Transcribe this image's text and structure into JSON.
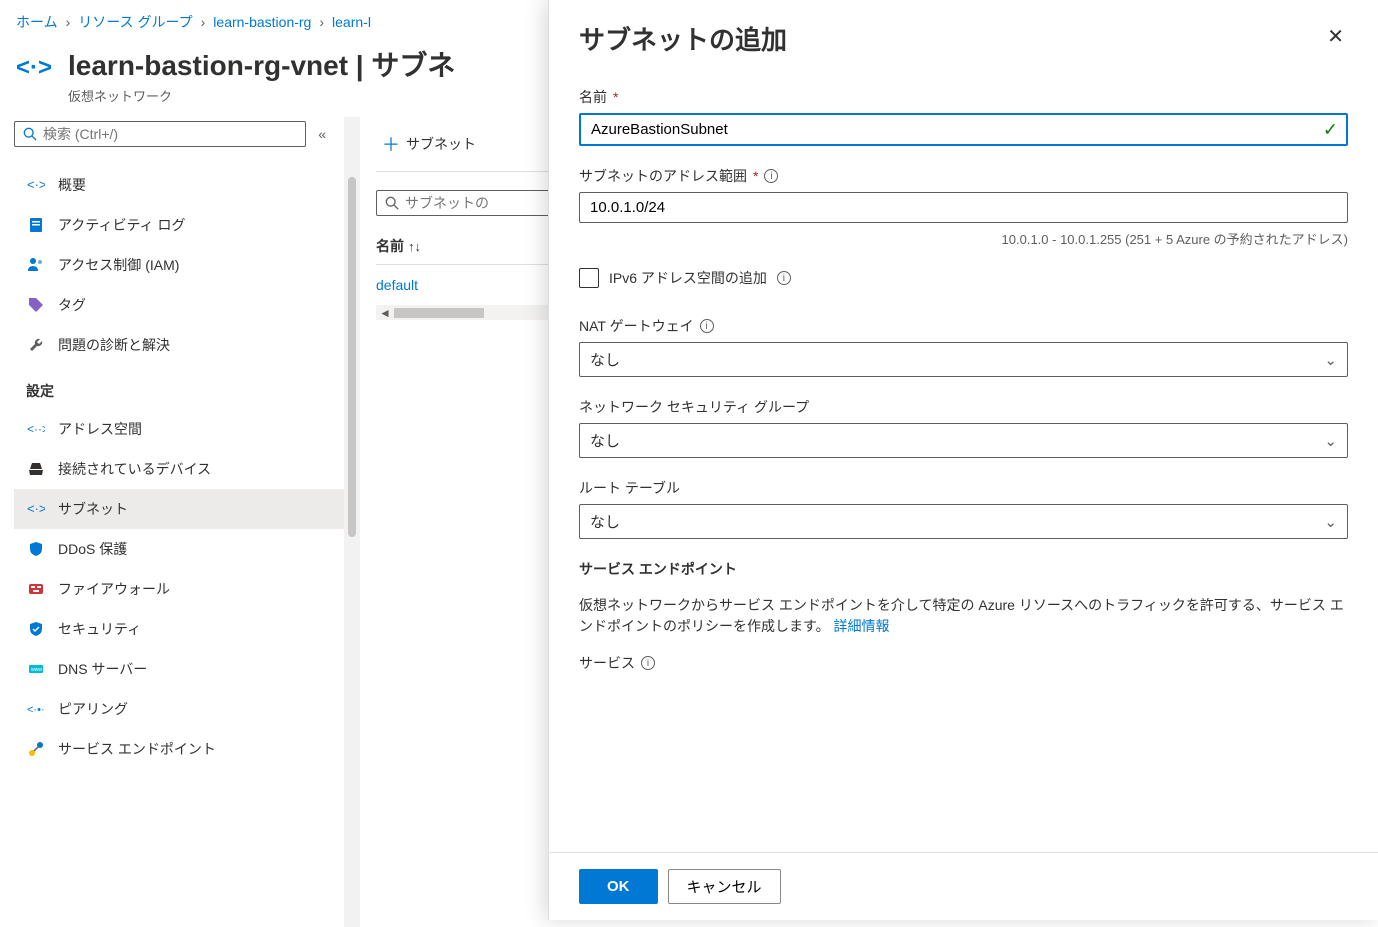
{
  "breadcrumb": {
    "items": [
      "ホーム",
      "リソース グループ",
      "learn-bastion-rg",
      "learn-l"
    ]
  },
  "header": {
    "title": "learn-bastion-rg-vnet | サブネ",
    "subtitle": "仮想ネットワーク"
  },
  "search_placeholder": "検索 (Ctrl+/)",
  "nav": {
    "items": [
      "概要",
      "アクティビティ ログ",
      "アクセス制御 (IAM)",
      "タグ",
      "問題の診断と解決"
    ],
    "section": "設定",
    "settings": [
      "アドレス空間",
      "接続されているデバイス",
      "サブネット",
      "DDoS 保護",
      "ファイアウォール",
      "セキュリティ",
      "DNS サーバー",
      "ピアリング",
      "サービス エンドポイント"
    ]
  },
  "toolbar": {
    "add": "サブネット"
  },
  "subnet_search_placeholder": "サブネットの",
  "table": {
    "col_name": "名前",
    "row1": "default"
  },
  "panel": {
    "title": "サブネットの追加",
    "name_label": "名前",
    "name_value": "AzureBastionSubnet",
    "addr_label": "サブネットのアドレス範囲",
    "addr_value": "10.0.1.0/24",
    "addr_hint": "10.0.1.0 - 10.0.1.255 (251 + 5 Azure の予約されたアドレス)",
    "ipv6_label": "IPv6 アドレス空間の追加",
    "nat_label": "NAT ゲートウェイ",
    "nat_value": "なし",
    "nsg_label": "ネットワーク セキュリティ グループ",
    "nsg_value": "なし",
    "rt_label": "ルート テーブル",
    "rt_value": "なし",
    "se_title": "サービス エンドポイント",
    "se_desc": "仮想ネットワークからサービス エンドポイントを介して特定の Azure リソースへのトラフィックを許可する、サービス エンドポイントのポリシーを作成します。",
    "se_link": "詳細情報",
    "service_label": "サービス",
    "ok": "OK",
    "cancel": "キャンセル"
  }
}
